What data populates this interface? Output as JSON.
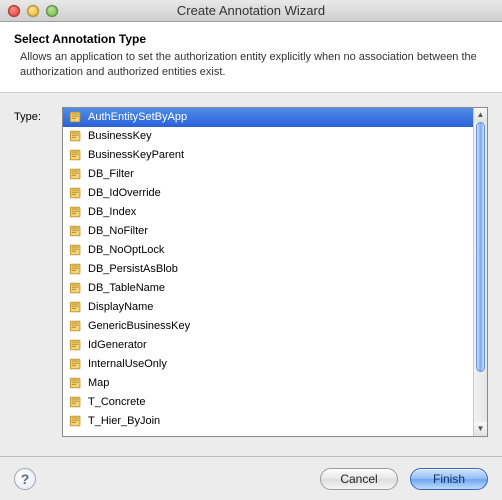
{
  "window": {
    "title": "Create Annotation Wizard"
  },
  "header": {
    "title": "Select Annotation Type",
    "description": "Allows an application to set the authorization entity explicitly when no association between the authorization and authorized entities exist."
  },
  "field": {
    "label": "Type:"
  },
  "list": {
    "selected_index": 0,
    "items": [
      "AuthEntitySetByApp",
      "BusinessKey",
      "BusinessKeyParent",
      "DB_Filter",
      "DB_IdOverride",
      "DB_Index",
      "DB_NoFilter",
      "DB_NoOptLock",
      "DB_PersistAsBlob",
      "DB_TableName",
      "DisplayName",
      "GenericBusinessKey",
      "IdGenerator",
      "InternalUseOnly",
      "Map",
      "T_Concrete",
      "T_Hier_ByJoin"
    ]
  },
  "buttons": {
    "help_tooltip": "?",
    "cancel": "Cancel",
    "finish": "Finish"
  }
}
